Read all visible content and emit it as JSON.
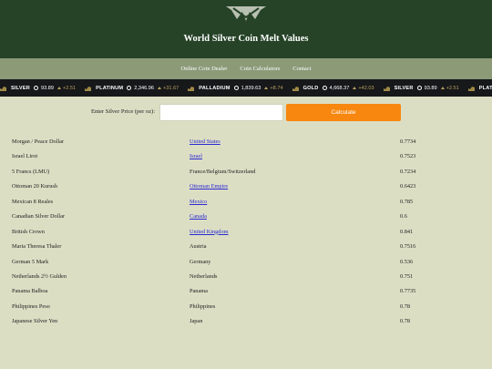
{
  "header": {
    "title": "World Silver Coin Melt Values",
    "logo": "crossed-ornament-logo"
  },
  "nav": {
    "items": [
      "Online Coin Dealer",
      "Coin Calculators",
      "Contact"
    ]
  },
  "ticker": [
    {
      "name": "SILVER",
      "price": "93.89",
      "change": "+2.51"
    },
    {
      "name": "PLATINUM",
      "price": "2,346.96",
      "change": "+31.67"
    },
    {
      "name": "PALLADIUM",
      "price": "1,839.63",
      "change": "+8.74"
    },
    {
      "name": "GOLD",
      "price": "4,668.37",
      "change": "+42.03"
    },
    {
      "name": "SILVER",
      "price": "93.89",
      "change": "+2.51"
    },
    {
      "name": "PLATIN",
      "price": "",
      "change": ""
    }
  ],
  "calculator": {
    "label": "Enter Silver Price (per oz):",
    "value": "",
    "button": "Calculate"
  },
  "coins": [
    {
      "name": "Morgan / Peace Dollar",
      "country": "United States",
      "link": true,
      "value": "0.7734"
    },
    {
      "name": "Israel Lirot",
      "country": "Israel",
      "link": true,
      "value": "0.7523"
    },
    {
      "name": "5 Francs (LMU)",
      "country": "France/Belgium/Switzerland",
      "link": false,
      "value": "0.7234"
    },
    {
      "name": "Ottoman 20 Kurush",
      "country": "Ottoman Empire",
      "link": true,
      "value": "0.6423"
    },
    {
      "name": "Mexican 8 Reales",
      "country": "Mexico",
      "link": true,
      "value": "0.785"
    },
    {
      "name": "Canadian Silver Dollar",
      "country": "Canada",
      "link": true,
      "value": "0.6"
    },
    {
      "name": "British Crown",
      "country": "United Kingdom",
      "link": true,
      "value": "0.841"
    },
    {
      "name": "Maria Theresa Thaler",
      "country": "Austria",
      "link": false,
      "value": "0.7516"
    },
    {
      "name": "German 5 Mark",
      "country": "Germany",
      "link": false,
      "value": "0.536"
    },
    {
      "name": "Netherlands 2½ Gulden",
      "country": "Netherlands",
      "link": false,
      "value": "0.751"
    },
    {
      "name": "Panama Balboa",
      "country": "Panama",
      "link": false,
      "value": "0.7735"
    },
    {
      "name": "Philippines Peso",
      "country": "Philippines",
      "link": false,
      "value": "0.78"
    },
    {
      "name": "Japanese Silver Yen",
      "country": "Japan",
      "link": false,
      "value": "0.78"
    }
  ]
}
